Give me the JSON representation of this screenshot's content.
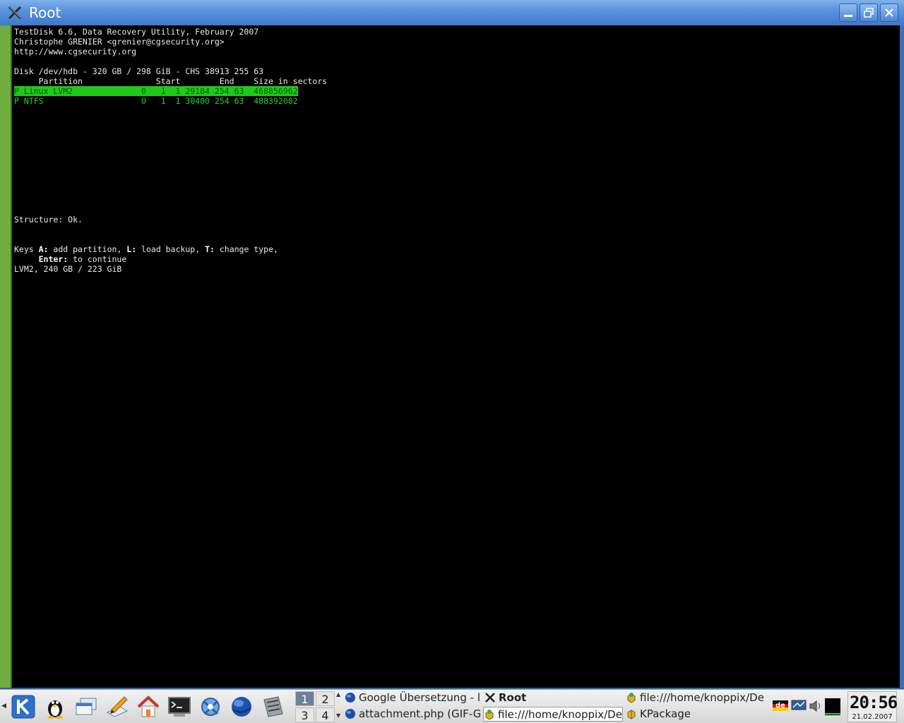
{
  "window": {
    "title": "Root"
  },
  "terminal": {
    "lines": [
      "TestDisk 6.6, Data Recovery Utility, February 2007",
      "Christophe GRENIER <grenier@cgsecurity.org>",
      "http://www.cgsecurity.org",
      "Disk /dev/hdb - 320 GB / 298 GiB - CHS 38913 255 63",
      "     Partition               Start        End    Size in sectors"
    ],
    "partitions": [
      "P Linux LVM2              0   1  1 29184 254 63  468856962",
      "P NTFS                    0   1  1 30400 254 63  488392002"
    ],
    "structure": "Structure: Ok.",
    "keys": {
      "prefix": "Keys ",
      "k1": "A:",
      "t1": " add partition, ",
      "k2": "L:",
      "t2": " load backup, ",
      "k3": "T:",
      "t3": " change type,",
      "indent": "     ",
      "k4": "Enter:",
      "t4": " to continue"
    },
    "info": "LVM2, 240 GB / 223 GiB"
  },
  "taskbar": {
    "pager": [
      "1",
      "2",
      "3",
      "4"
    ],
    "tasks": [
      "Google Übersetzung - lc",
      "Root",
      "file:///home/knoppix/Des",
      "attachment.php (GIF-Gr",
      "file:///home/knoppix/Des",
      "KPackage"
    ],
    "tray": {
      "keyboard": "de"
    },
    "clock": {
      "time": "20:56",
      "date": "21.02.2007"
    }
  },
  "colors": {
    "title_blue": "#3f78c8",
    "terminal_bg": "#000000",
    "highlight_green": "#20c81a",
    "text_green": "#28d21e"
  }
}
